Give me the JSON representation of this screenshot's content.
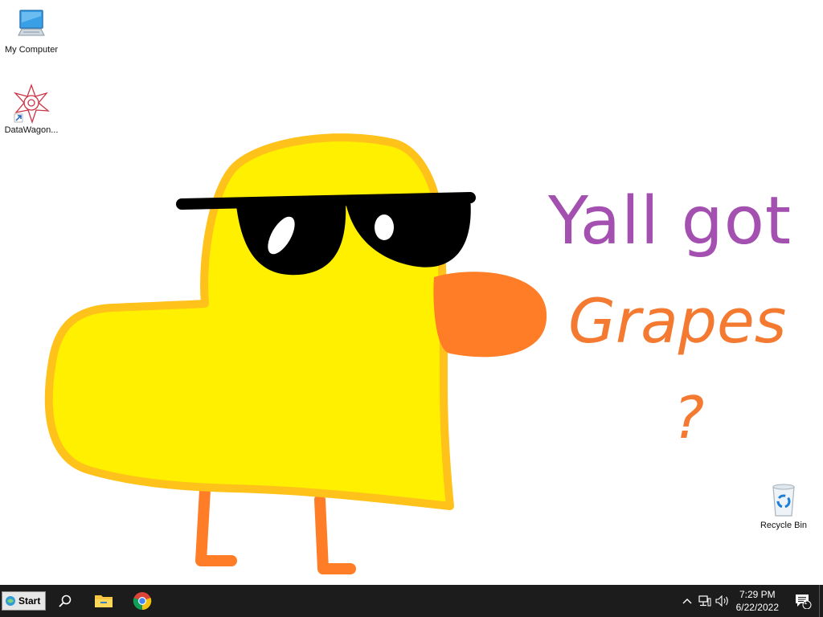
{
  "desktop": {
    "icons": [
      {
        "label": "My Computer",
        "icon": "computer-icon"
      },
      {
        "label": "DataWagon...",
        "icon": "datawagon-logo-icon"
      },
      {
        "label": "Recycle Bin",
        "icon": "recycle-bin-icon"
      }
    ],
    "wallpaper": {
      "line1": "Yall got",
      "line2": "Grapes",
      "line3": "?",
      "colors": {
        "purple_text": "#a350b0",
        "orange_text": "#f37a30",
        "duck_body": "#fff000",
        "duck_outline": "#ffc21a",
        "beak": "#ff7d26",
        "glasses": "#000000"
      }
    }
  },
  "taskbar": {
    "start_label": "Start",
    "pinned": [
      "search-icon",
      "file-explorer-icon",
      "chrome-icon"
    ],
    "tray": {
      "icons": [
        "chevron-up-icon",
        "network-icon",
        "volume-icon"
      ],
      "time": "7:29 PM",
      "date": "6/22/2022",
      "notification_count": "1"
    }
  }
}
